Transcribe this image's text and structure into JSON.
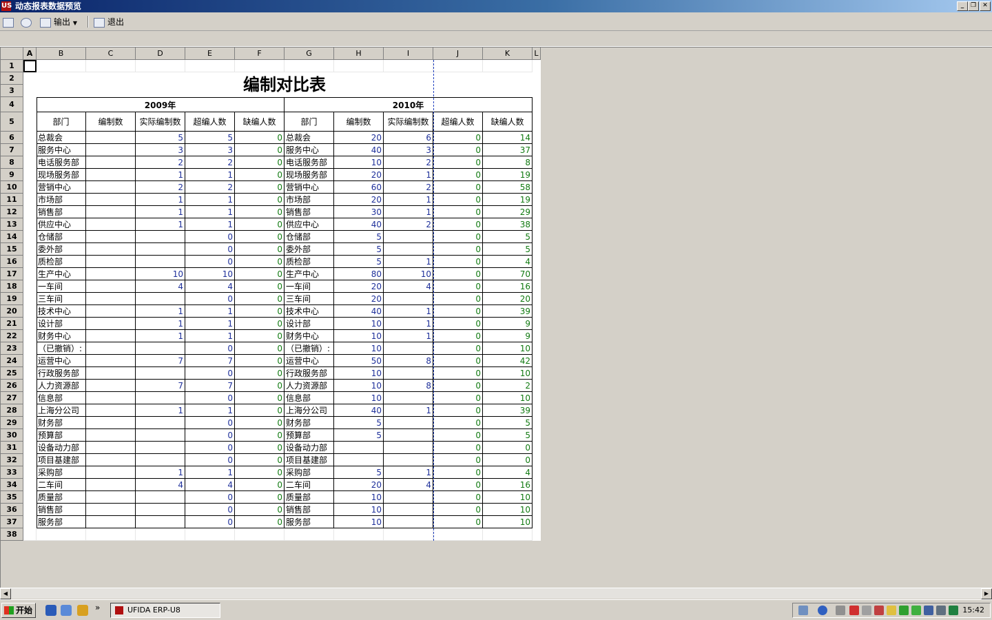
{
  "window": {
    "title": "动态报表数据预览",
    "app_icon": "US"
  },
  "toolbar": {
    "export_label": "输出",
    "exit_label": "退出"
  },
  "columns": [
    "A",
    "B",
    "C",
    "D",
    "E",
    "F",
    "G",
    "H",
    "I",
    "J",
    "K",
    "L"
  ],
  "rows": [
    "1",
    "2",
    "3",
    "4",
    "5",
    "6",
    "7",
    "8",
    "9",
    "10",
    "11",
    "12",
    "13",
    "14",
    "15",
    "16",
    "17",
    "18",
    "19",
    "20",
    "21",
    "22",
    "23",
    "24",
    "25",
    "26",
    "27",
    "28",
    "29",
    "30",
    "31",
    "32",
    "33",
    "34",
    "35",
    "36",
    "37",
    "38"
  ],
  "report": {
    "title": "编制对比表",
    "year_left": "2009年",
    "year_right": "2010年",
    "headers": [
      "部门",
      "编制数",
      "实际编制数",
      "超编人数",
      "缺编人数",
      "部门",
      "编制数",
      "实际编制数",
      "超编人数",
      "缺编人数"
    ],
    "data": [
      [
        "总裁会",
        "",
        "5",
        "5",
        "0",
        "总裁会",
        "20",
        "6",
        "0",
        "14"
      ],
      [
        "服务中心",
        "",
        "3",
        "3",
        "0",
        "服务中心",
        "40",
        "3",
        "0",
        "37"
      ],
      [
        "电话服务部",
        "",
        "2",
        "2",
        "0",
        "电话服务部",
        "10",
        "2",
        "0",
        "8"
      ],
      [
        "现场服务部",
        "",
        "1",
        "1",
        "0",
        "现场服务部",
        "20",
        "1",
        "0",
        "19"
      ],
      [
        "营销中心",
        "",
        "2",
        "2",
        "0",
        "营销中心",
        "60",
        "2",
        "0",
        "58"
      ],
      [
        "市场部",
        "",
        "1",
        "1",
        "0",
        "市场部",
        "20",
        "1",
        "0",
        "19"
      ],
      [
        "销售部",
        "",
        "1",
        "1",
        "0",
        "销售部",
        "30",
        "1",
        "0",
        "29"
      ],
      [
        "供应中心",
        "",
        "1",
        "1",
        "0",
        "供应中心",
        "40",
        "2",
        "0",
        "38"
      ],
      [
        "仓储部",
        "",
        "",
        "0",
        "0",
        "仓储部",
        "5",
        "",
        "0",
        "5"
      ],
      [
        "委外部",
        "",
        "",
        "0",
        "0",
        "委外部",
        "5",
        "",
        "0",
        "5"
      ],
      [
        "质检部",
        "",
        "",
        "0",
        "0",
        "质检部",
        "5",
        "1",
        "0",
        "4"
      ],
      [
        "生产中心",
        "",
        "10",
        "10",
        "0",
        "生产中心",
        "80",
        "10",
        "0",
        "70"
      ],
      [
        "一车间",
        "",
        "4",
        "4",
        "0",
        "一车间",
        "20",
        "4",
        "0",
        "16"
      ],
      [
        "三车间",
        "",
        "",
        "0",
        "0",
        "三车间",
        "20",
        "",
        "0",
        "20"
      ],
      [
        "技术中心",
        "",
        "1",
        "1",
        "0",
        "技术中心",
        "40",
        "1",
        "0",
        "39"
      ],
      [
        "设计部",
        "",
        "1",
        "1",
        "0",
        "设计部",
        "10",
        "1",
        "0",
        "9"
      ],
      [
        "财务中心",
        "",
        "1",
        "1",
        "0",
        "财务中心",
        "10",
        "1",
        "0",
        "9"
      ],
      [
        "（已撤销）:",
        "",
        "",
        "0",
        "0",
        "（已撤销）:",
        "10",
        "",
        "0",
        "10"
      ],
      [
        "运营中心",
        "",
        "7",
        "7",
        "0",
        "运营中心",
        "50",
        "8",
        "0",
        "42"
      ],
      [
        "行政服务部",
        "",
        "",
        "0",
        "0",
        "行政服务部",
        "10",
        "",
        "0",
        "10"
      ],
      [
        "人力资源部",
        "",
        "7",
        "7",
        "0",
        "人力资源部",
        "10",
        "8",
        "0",
        "2"
      ],
      [
        "信息部",
        "",
        "",
        "0",
        "0",
        "信息部",
        "10",
        "",
        "0",
        "10"
      ],
      [
        "上海分公司",
        "",
        "1",
        "1",
        "0",
        "上海分公司",
        "40",
        "1",
        "0",
        "39"
      ],
      [
        "财务部",
        "",
        "",
        "0",
        "0",
        "财务部",
        "5",
        "",
        "0",
        "5"
      ],
      [
        "预算部",
        "",
        "",
        "0",
        "0",
        "预算部",
        "5",
        "",
        "0",
        "5"
      ],
      [
        "设备动力部",
        "",
        "",
        "0",
        "0",
        "设备动力部",
        "",
        "",
        "0",
        "0"
      ],
      [
        "项目基建部",
        "",
        "",
        "0",
        "0",
        "项目基建部",
        "",
        "",
        "0",
        "0"
      ],
      [
        "采购部",
        "",
        "1",
        "1",
        "0",
        "采购部",
        "5",
        "1",
        "0",
        "4"
      ],
      [
        "二车间",
        "",
        "4",
        "4",
        "0",
        "二车间",
        "20",
        "4",
        "0",
        "16"
      ],
      [
        "质量部",
        "",
        "",
        "0",
        "0",
        "质量部",
        "10",
        "",
        "0",
        "10"
      ],
      [
        "销售部",
        "",
        "",
        "0",
        "0",
        "销售部",
        "10",
        "",
        "0",
        "10"
      ],
      [
        "服务部",
        "",
        "",
        "0",
        "0",
        "服务部",
        "10",
        "",
        "0",
        "10"
      ]
    ]
  },
  "taskbar": {
    "start_label": "开始",
    "task_label": "UFIDA ERP-U8",
    "clock": "15:42"
  },
  "colors": {
    "blue_value": "#1d2f9a",
    "green_value": "#117a11",
    "title_bar": "#0a246a"
  }
}
